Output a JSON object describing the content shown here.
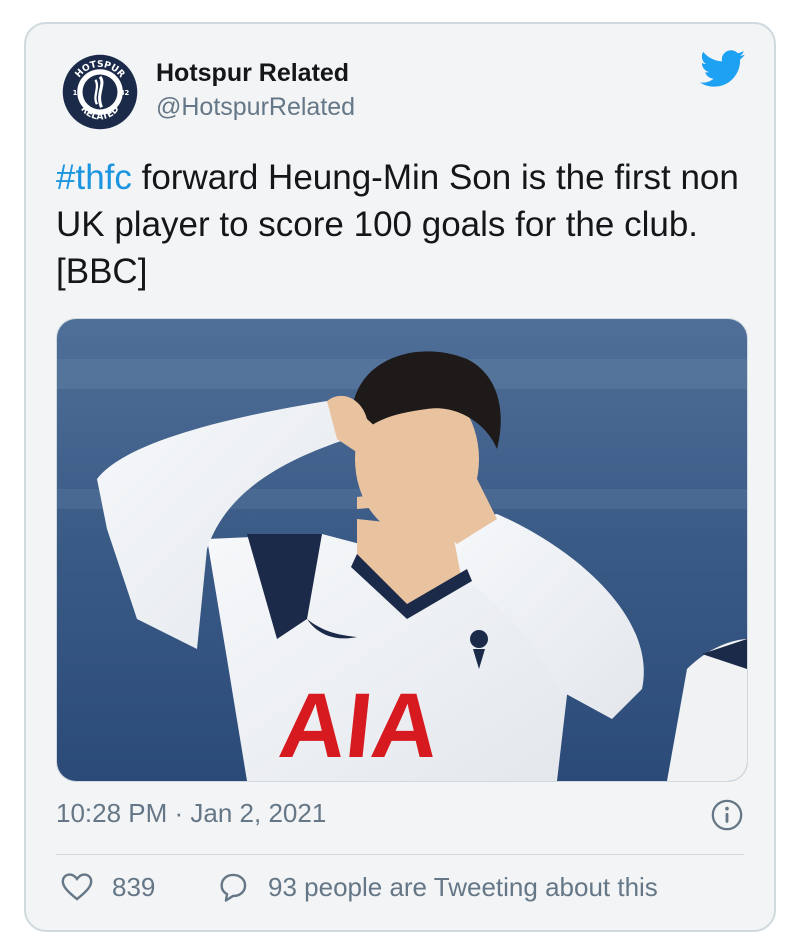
{
  "author": {
    "name": "Hotspur Related",
    "handle": "@HotspurRelated",
    "logo_text": {
      "top": "HOTSPUR",
      "bottom": "RELATED",
      "left_year": "18",
      "right_year": "82"
    }
  },
  "tweet": {
    "hashtag": "#thfc",
    "text": " forward Heung-Min Son is the first non UK player to score 100 goals for the club. [BBC]",
    "photo": {
      "shirt_sponsor": "AIA"
    }
  },
  "meta": {
    "timestamp": "10:28 PM · Jan 2, 2021"
  },
  "actions": {
    "likes": "839",
    "conversation": "93 people are Tweeting about this"
  },
  "colors": {
    "accent": "#1b95e0",
    "twitter_blue": "#1da1f2",
    "muted": "#657786",
    "sponsor_red": "#d71920"
  },
  "icons": {
    "brand": "twitter-bird-icon",
    "info": "info-icon",
    "like": "heart-icon",
    "reply": "speech-bubble-icon"
  }
}
